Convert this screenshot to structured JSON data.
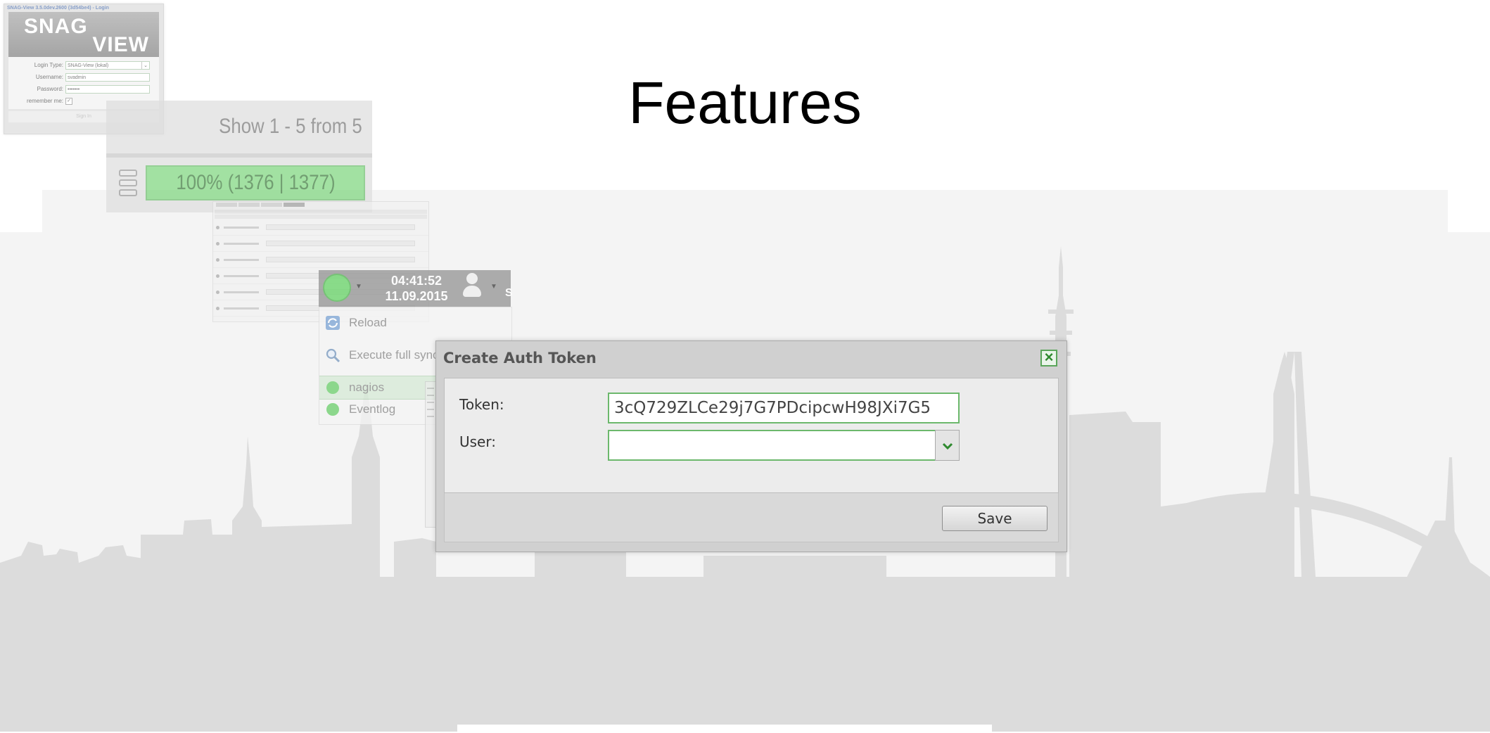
{
  "slide": {
    "title": "Features"
  },
  "login": {
    "window_title": "SNAG-View 3.5.0dev.2600 (3d54be4) - Login",
    "logo_line1": "SNAG",
    "logo_line2": "VIEW",
    "login_type_label": "Login Type:",
    "login_type_value": "SNAG-View (lokal)",
    "username_label": "Username:",
    "username_value": "svadmin",
    "password_label": "Password:",
    "password_value": "•••••••",
    "remember_label": "remember me:",
    "remember_checked": true,
    "signin_label": "Sign In"
  },
  "pager": {
    "text": "Show 1 - 5 from 5",
    "progress_text": "100% (1376 | 1377)",
    "progress_fraction": 1.0
  },
  "header": {
    "time": "04:41:52",
    "date": "11.09.2015",
    "user_initial": "S"
  },
  "menu": {
    "reload": "Reload",
    "execute": "Execute full synch",
    "nagios": "nagios",
    "eventlog": "Eventlog"
  },
  "dialog": {
    "title": "Create Auth Token",
    "token_label": "Token:",
    "token_value": "3cQ729ZLCe29j7G7PDcipcwH98JXi7G5",
    "user_label": "User:",
    "user_value": "",
    "save_label": "Save"
  },
  "colors": {
    "accent_green": "#5aa55a",
    "skyline_gray": "#dcdcdc",
    "progress_green": "#7fd67f"
  }
}
